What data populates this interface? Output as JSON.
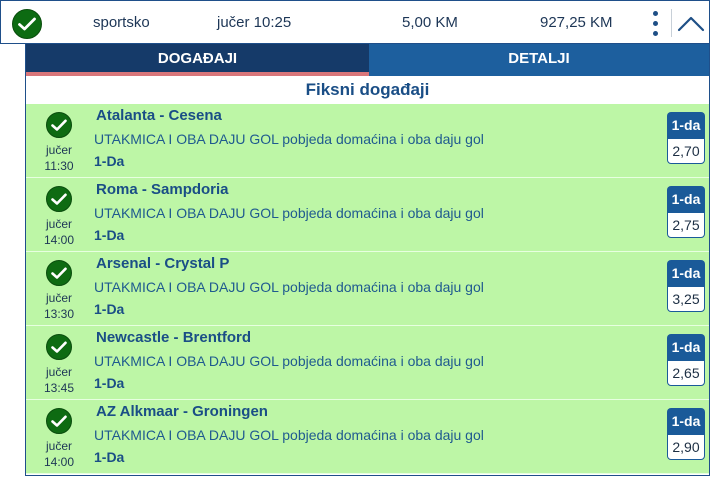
{
  "ticket": {
    "type": "sportsko",
    "datetime": "jučer 10:25",
    "stake": "5,00 KM",
    "payout": "927,25 KM"
  },
  "tabs": {
    "events": "DOGAĐAJI",
    "details": "DETALJI"
  },
  "section_title": "Fiksni događaji",
  "events": [
    {
      "match": "Atalanta - Cesena",
      "market": "UTAKMICA I OBA DAJU GOL pobjeda domaćina i oba daju gol",
      "pick": "1-Da",
      "day": "jučer",
      "time": "11:30",
      "odd_label": "1-da",
      "odd": "2,70"
    },
    {
      "match": "Roma - Sampdoria",
      "market": "UTAKMICA I OBA DAJU GOL pobjeda domaćina i oba daju gol",
      "pick": "1-Da",
      "day": "jučer",
      "time": "14:00",
      "odd_label": "1-da",
      "odd": "2,75"
    },
    {
      "match": "Arsenal - Crystal P",
      "market": "UTAKMICA I OBA DAJU GOL pobjeda domaćina i oba daju gol",
      "pick": "1-Da",
      "day": "jučer",
      "time": "13:30",
      "odd_label": "1-da",
      "odd": "3,25"
    },
    {
      "match": "Newcastle - Brentford",
      "market": "UTAKMICA I OBA DAJU GOL pobjeda domaćina i oba daju gol",
      "pick": "1-Da",
      "day": "jučer",
      "time": "13:45",
      "odd_label": "1-da",
      "odd": "2,65"
    },
    {
      "match": "AZ Alkmaar - Groningen",
      "market": "UTAKMICA I OBA DAJU GOL pobjeda domaćina i oba daju gol",
      "pick": "1-Da",
      "day": "jučer",
      "time": "14:00",
      "odd_label": "1-da",
      "odd": "2,90"
    }
  ],
  "icons": {
    "status": "check-circle-icon",
    "menu": "more-vertical-icon",
    "collapse": "chevron-up-icon"
  },
  "colors": {
    "won_row": "#bdf6a6",
    "primary": "#1a4e86",
    "check": "#0e6b12"
  }
}
